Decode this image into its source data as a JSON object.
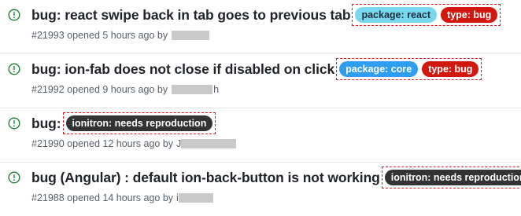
{
  "issues": [
    {
      "title": "bug: react swipe back in tab goes to previous tab",
      "meta": "#21993 opened 5 hours ago by",
      "author_tail": "",
      "labels": [
        {
          "text": "package: react",
          "bg": "#78d8ee",
          "fg": "#1b2e3c"
        },
        {
          "text": "type: bug",
          "bg": "#d2170f",
          "fg": "#ffffff"
        }
      ]
    },
    {
      "title": "bug: ion-fab does not close if disabled on click",
      "meta": "#21992 opened 9 hours ago by",
      "author_tail": "h",
      "labels": [
        {
          "text": "package: core",
          "bg": "#2f9df0",
          "fg": "#ffffff"
        },
        {
          "text": "type: bug",
          "bg": "#d2170f",
          "fg": "#ffffff"
        }
      ]
    },
    {
      "title": "bug:",
      "meta": "#21990 opened 12 hours ago by",
      "author_tail": "J",
      "labels": [
        {
          "text": "ionitron: needs reproduction",
          "bg": "#333333",
          "fg": "#ffffff"
        }
      ]
    },
    {
      "title": "bug (Angular) : default ion-back-button is not working",
      "meta": "#21988 opened 14 hours ago by",
      "author_tail": "i",
      "labels": [
        {
          "text": "ionitron: needs reproduction",
          "bg": "#333333",
          "fg": "#ffffff"
        }
      ]
    }
  ],
  "colors": {
    "open_icon": "#1a7f37",
    "highlight_border": "#e2141d"
  },
  "icons": {
    "status": "issue-opened-icon"
  }
}
